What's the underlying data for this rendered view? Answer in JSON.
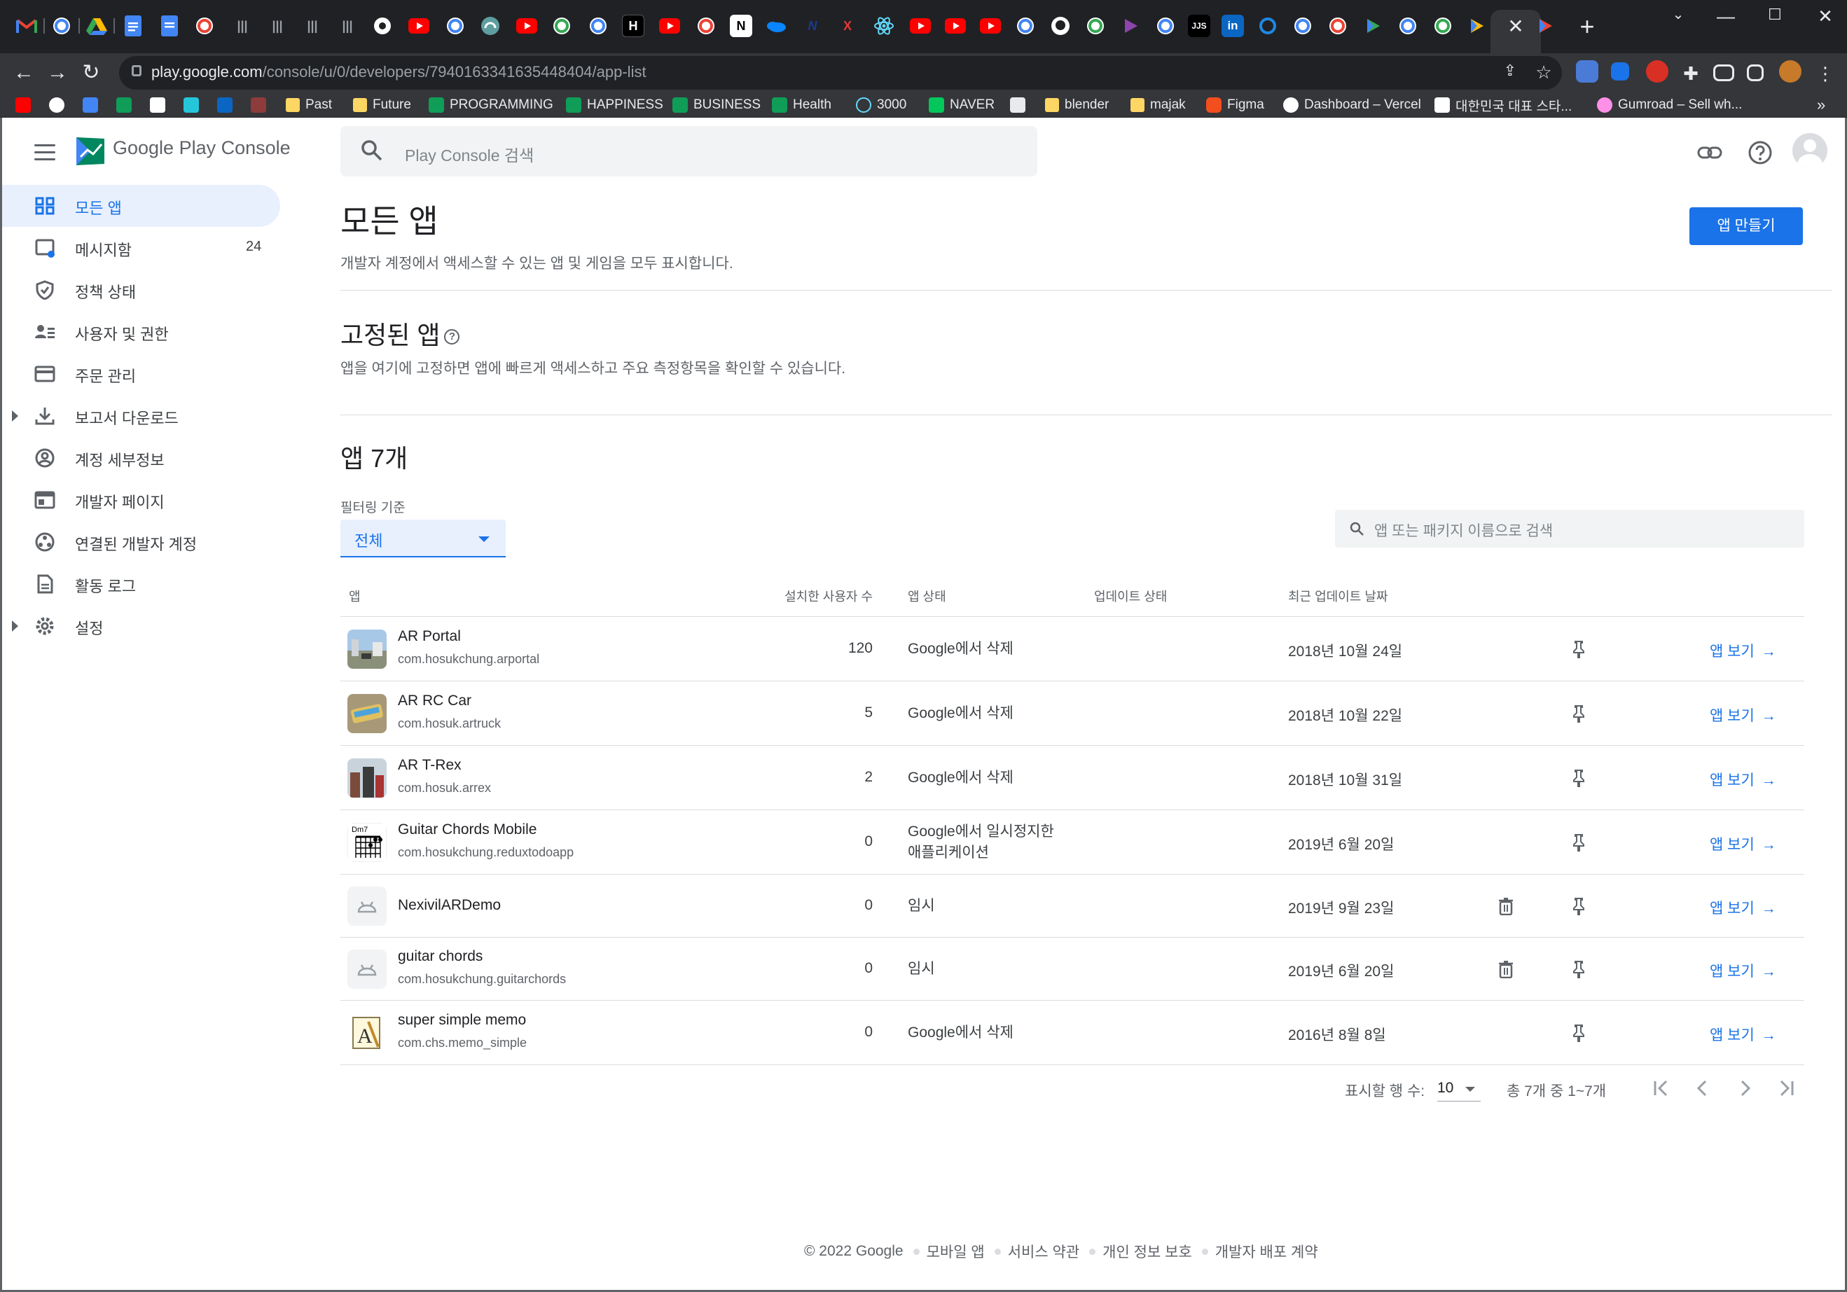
{
  "browser": {
    "url_host": "play.google.com",
    "url_path": "/console/u/0/developers/7940163341635448404/app-list",
    "tab_close": "✕",
    "new_tab": "+",
    "bookmarks": [
      {
        "label": "Past",
        "type": "folder"
      },
      {
        "label": "Future",
        "type": "folder"
      },
      {
        "label": "PROGRAMMING",
        "type": "sheet"
      },
      {
        "label": "HAPPINESS",
        "type": "sheet"
      },
      {
        "label": "BUSINESS",
        "type": "sheet"
      },
      {
        "label": "Health",
        "type": "sheet"
      },
      {
        "label": "3000",
        "type": "react"
      },
      {
        "label": "NAVER",
        "type": "naver"
      },
      {
        "label": "blender",
        "type": "folder"
      },
      {
        "label": "majak",
        "type": "folder"
      },
      {
        "label": "Figma",
        "type": "figma"
      },
      {
        "label": "Dashboard – Vercel",
        "type": "vercel"
      },
      {
        "label": "대한민국 대표 스타...",
        "type": "notion"
      },
      {
        "label": "Gumroad – Sell wh...",
        "type": "gumroad"
      }
    ],
    "bookmarks_overflow": "»"
  },
  "console": {
    "brand_google_play": "Google Play",
    "brand_console": "Console",
    "search_placeholder": "Play Console 검색"
  },
  "sidebar": {
    "items": [
      {
        "label": "모든 앱",
        "icon": "grid-icon",
        "active": true
      },
      {
        "label": "메시지함",
        "icon": "inbox-icon",
        "badge": "24"
      },
      {
        "label": "정책 상태",
        "icon": "shield-check-icon"
      },
      {
        "label": "사용자 및 권한",
        "icon": "people-list-icon"
      },
      {
        "label": "주문 관리",
        "icon": "credit-card-icon"
      },
      {
        "label": "보고서 다운로드",
        "icon": "download-icon",
        "expandable": true
      },
      {
        "label": "계정 세부정보",
        "icon": "account-circle-icon"
      },
      {
        "label": "개발자 페이지",
        "icon": "web-page-icon"
      },
      {
        "label": "연결된 개발자 계정",
        "icon": "linked-accounts-icon"
      },
      {
        "label": "활동 로그",
        "icon": "document-icon"
      },
      {
        "label": "설정",
        "icon": "gear-icon",
        "expandable": true
      }
    ]
  },
  "main": {
    "title": "모든 앱",
    "subtitle": "개발자 계정에서 액세스할 수 있는 앱 및 게임을 모두 표시합니다.",
    "create_button": "앱 만들기",
    "pinned_title": "고정된 앱",
    "pinned_help": "?",
    "pinned_note": "앱을 여기에 고정하면 앱에 빠르게 액세스하고 주요 측정항목을 확인할 수 있습니다.",
    "apps_count_title": "앱 7개",
    "filter_label": "필터링 기준",
    "filter_value": "전체",
    "table_search_placeholder": "앱 또는 패키지 이름으로 검색"
  },
  "table": {
    "columns": [
      "앱",
      "설치한 사용자 수",
      "앱 상태",
      "업데이트 상태",
      "최근 업데이트 날짜"
    ],
    "view_label": "앱 보기",
    "rows": [
      {
        "name": "AR Portal",
        "package": "com.hosukchung.arportal",
        "installs": "120",
        "status": "Google에서 삭제",
        "status2": "",
        "date": "2018년 10월 24일",
        "deletable": false,
        "thumb": "photo-street"
      },
      {
        "name": "AR RC Car",
        "package": "com.hosuk.artruck",
        "installs": "5",
        "status": "Google에서 삭제",
        "status2": "",
        "date": "2018년 10월 22일",
        "deletable": false,
        "thumb": "photo-car"
      },
      {
        "name": "AR T-Rex",
        "package": "com.hosuk.arrex",
        "installs": "2",
        "status": "Google에서 삭제",
        "status2": "",
        "date": "2018년 10월 31일",
        "deletable": false,
        "thumb": "photo-trex"
      },
      {
        "name": "Guitar Chords Mobile",
        "package": "com.hosukchung.reduxtodoapp",
        "installs": "0",
        "status": "Google에서 일시정지한",
        "status2": "애플리케이션",
        "date": "2019년 6월 20일",
        "deletable": false,
        "thumb": "chord",
        "thumb_text": "Dm7"
      },
      {
        "name": "NexivilARDemo",
        "package": "",
        "installs": "0",
        "status": "임시",
        "status2": "",
        "date": "2019년 9월 23일",
        "deletable": true,
        "thumb": "android"
      },
      {
        "name": "guitar chords",
        "package": "com.hosukchung.guitarchords",
        "installs": "0",
        "status": "임시",
        "status2": "",
        "date": "2019년 6월 20일",
        "deletable": true,
        "thumb": "android"
      },
      {
        "name": "super simple memo",
        "package": "com.chs.memo_simple",
        "installs": "0",
        "status": "Google에서 삭제",
        "status2": "",
        "date": "2016년 8월 8일",
        "deletable": false,
        "thumb": "memo"
      }
    ]
  },
  "pagination": {
    "rows_label": "표시할 행 수:",
    "rows_value": "10",
    "range": "총 7개 중 1~7개"
  },
  "footer": {
    "copyright": "© 2022 Google",
    "links": [
      "모바일 앱",
      "서비스 약관",
      "개인 정보 보호",
      "개발자 배포 계약"
    ]
  },
  "colors": {
    "accent": "#1a73e8",
    "active_nav_bg": "#e8f0fe",
    "chrome_dark": "#202124",
    "chrome_toolbar": "#35363a"
  }
}
